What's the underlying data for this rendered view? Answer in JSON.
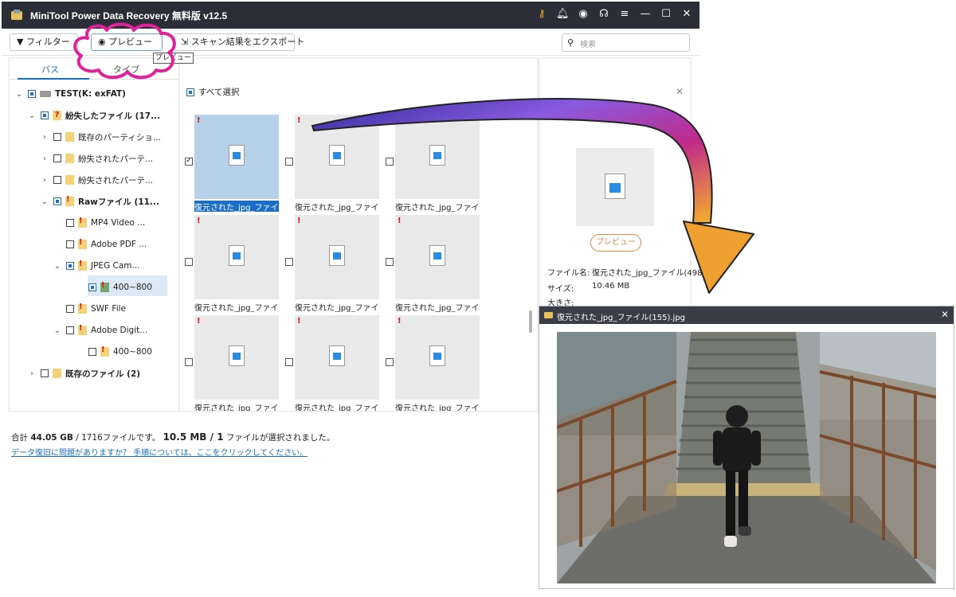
{
  "window": {
    "title": "MiniTool Power Data Recovery 無料版 v12.5",
    "controls": [
      "key-icon",
      "bell-icon",
      "disc-icon",
      "headset-icon",
      "menu-icon",
      "minimize-icon",
      "maximize-icon",
      "close-icon"
    ]
  },
  "toolbar": {
    "filter_label": "フィルター",
    "preview_label": "プレビュー",
    "export_label": "スキャン結果をエクスポート",
    "search_placeholder": "検索",
    "tooltip": "プレビュー"
  },
  "tabs": {
    "path": "パス",
    "type": "タイプ"
  },
  "tree": [
    {
      "label": "TEST(K: exFAT)",
      "bold": true
    },
    {
      "label": "紛失したファイル (17...",
      "bold": true
    },
    {
      "label": "既存のパーティショ..."
    },
    {
      "label": "紛失されたパーテ..."
    },
    {
      "label": "紛失されたパーテ..."
    },
    {
      "label": "Rawファイル (11...",
      "bold": true
    },
    {
      "label": "MP4 Video ..."
    },
    {
      "label": "Adobe PDF ..."
    },
    {
      "label": "JPEG Cam..."
    },
    {
      "label": "400~800"
    },
    {
      "label": "SWF File"
    },
    {
      "label": "Adobe Digit..."
    },
    {
      "label": "400~800"
    },
    {
      "label": "既存のファイル (2)",
      "bold": true
    }
  ],
  "center": {
    "select_all": "すべて選択",
    "thumbs": [
      "復元された_jpg_ファイ...",
      "復元された_jpg_ファイ...",
      "復元された_jpg_ファイ...",
      "復元された_jpg_ファイ...",
      "復元された_jpg_ファイ...",
      "復元された_jpg_ファイ...",
      "復元された_jpg_ファイ...",
      "復元された_jpg_ファイ...",
      "復元された_jpg_ファイ..."
    ]
  },
  "right": {
    "preview_button": "プレビュー",
    "filename_label": "ファイル名:",
    "filename_value": "復元された_jpg_ファイル(498",
    "size_label": "サイズ:",
    "size_value": "10.46 MB",
    "dimension_label": "大きさ:"
  },
  "summary": {
    "prefix": "合計",
    "total": "44.05 GB",
    "files_text": "/ 1716ファイルです。",
    "selected": "10.5 MB / 1",
    "suffix": "ファイルが選択されました。",
    "help_link": "データ復旧に問題がありますか？ 手順については、ここをクリックしてください。"
  },
  "preview_window": {
    "title": "復元された_jpg_ファイル(155).jpg"
  },
  "colors": {
    "accent": "#1a6fc4",
    "titlebar": "#2b2e36",
    "annotation_pink": "#e0219a",
    "arrow_start": "#2a2a9a",
    "arrow_end": "#f5b02a"
  }
}
